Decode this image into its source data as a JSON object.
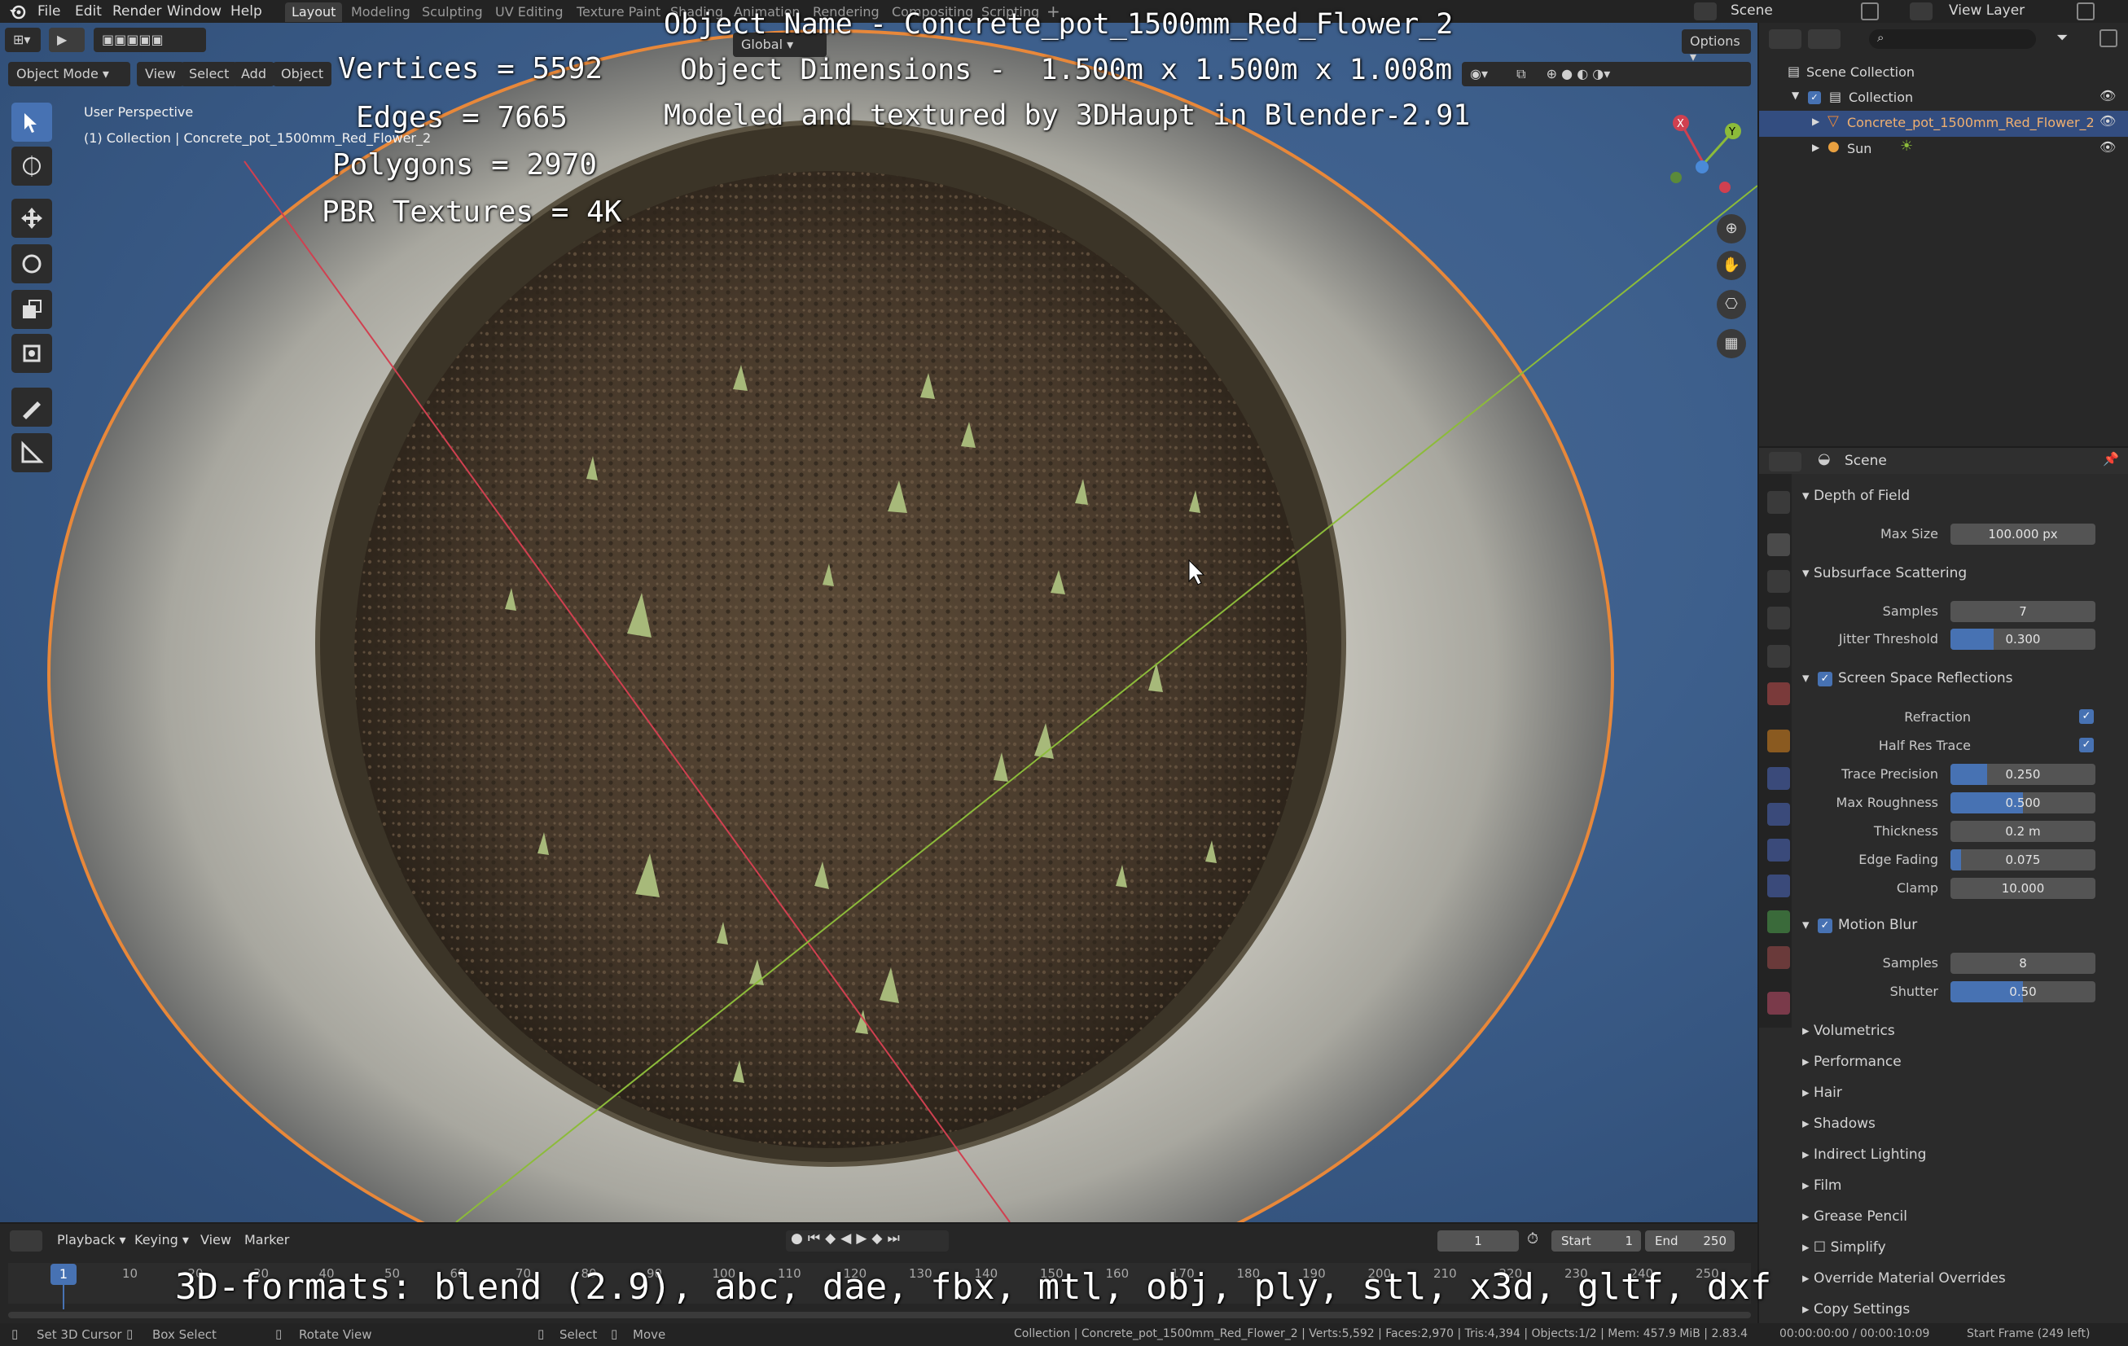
{
  "topbar": {
    "menus": [
      "File",
      "Edit",
      "Render",
      "Window",
      "Help"
    ],
    "workspaces": [
      "Layout",
      "Modeling",
      "Sculpting",
      "UV Editing",
      "Texture Paint",
      "Shading",
      "Animation",
      "Rendering",
      "Compositing",
      "Scripting"
    ],
    "active_workspace": "Layout",
    "scene_label": "Scene",
    "view_layer_label": "View Layer"
  },
  "viewport": {
    "mode": "Object Mode",
    "menus": [
      "View",
      "Select",
      "Add",
      "Object"
    ],
    "orientation": "Global",
    "options_label": "Options",
    "perspective_label": "User Perspective",
    "collection_info": "(1) Collection | Concrete_pot_1500mm_Red_Flower_2",
    "overlay": {
      "object_name": "Object Name - Concrete_pot_1500mm_Red_Flower_2",
      "dimensions": "Object Dimensions -  1.500m x 1.500m x 1.008m",
      "credit": "Modeled and textured by 3DHaupt in Blender-2.91",
      "vertices": "Vertices = 5592",
      "edges": "Edges = 7665",
      "polygons": "Polygons = 2970",
      "textures": "PBR Textures = 4K",
      "formats": "3D-formats: blend (2.9), abc, dae, fbx, mtl, obj, ply, stl, x3d, gltf, dxf"
    },
    "gizmo": {
      "x": "X",
      "y": "Y",
      "z": "Z"
    }
  },
  "outliner": {
    "root": "Scene Collection",
    "collection": "Collection",
    "items": [
      "Concrete_pot_1500mm_Red_Flower_2",
      "Sun"
    ]
  },
  "properties": {
    "context": "Scene",
    "depth_of_field": {
      "title": "Depth of Field",
      "max_size_label": "Max Size",
      "max_size": "100.000 px"
    },
    "subsurface": {
      "title": "Subsurface Scattering",
      "samples_label": "Samples",
      "samples": "7",
      "jitter_label": "Jitter Threshold",
      "jitter": "0.300",
      "jitter_fraction": 0.3
    },
    "ssr": {
      "title": "Screen Space Reflections",
      "refraction_label": "Refraction",
      "half_res_label": "Half Res Trace",
      "trace_precision_label": "Trace Precision",
      "trace_precision": "0.250",
      "trace_precision_fraction": 0.25,
      "max_roughness_label": "Max Roughness",
      "max_roughness": "0.500",
      "max_roughness_fraction": 0.5,
      "thickness_label": "Thickness",
      "thickness": "0.2 m",
      "edge_fading_label": "Edge Fading",
      "edge_fading": "0.075",
      "edge_fading_fraction": 0.075,
      "clamp_label": "Clamp",
      "clamp": "10.000"
    },
    "motion_blur": {
      "title": "Motion Blur",
      "samples_label": "Samples",
      "samples": "8",
      "shutter_label": "Shutter",
      "shutter": "0.50",
      "shutter_fraction": 0.5
    },
    "collapsed_panels": [
      "Volumetrics",
      "Performance",
      "Hair",
      "Shadows",
      "Indirect Lighting",
      "Film",
      "Grease Pencil",
      "Simplify",
      "Override Material Overrides",
      "Copy Settings"
    ]
  },
  "timeline": {
    "menus": [
      "Playback",
      "Keying",
      "View",
      "Marker"
    ],
    "current_frame": "1",
    "start_label": "Start",
    "start": "1",
    "end_label": "End",
    "end": "250",
    "ticks": [
      "10",
      "20",
      "30",
      "40",
      "50",
      "60",
      "70",
      "80",
      "90",
      "100",
      "110",
      "120",
      "130",
      "140",
      "150",
      "160",
      "170",
      "180",
      "190",
      "200",
      "210",
      "220",
      "230",
      "240",
      "250"
    ],
    "playhead": "1"
  },
  "statusbar": {
    "set_cursor": "Set 3D Cursor",
    "box_select": "Box Select",
    "rotate_view": "Rotate View",
    "select": "Select",
    "move": "Move",
    "stats": "Collection | Concrete_pot_1500mm_Red_Flower_2 | Verts:5,592 | Faces:2,970 | Tris:4,394 | Objects:1/2 | Mem: 457.9 MiB | 2.83.4",
    "time": "00:00:00:00 / 00:00:10:09",
    "start_frame": "Start Frame (249 left)"
  },
  "colors": {
    "accent": "#4772b3",
    "selection": "#e8883a",
    "axis_x": "#d04050",
    "axis_y": "#8cbb3a",
    "viewport_bg": "#3d5f8c"
  }
}
